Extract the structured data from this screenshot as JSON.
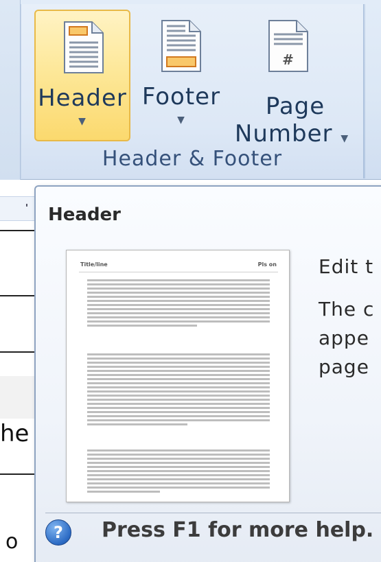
{
  "ribbon": {
    "buttons": {
      "header": {
        "label": "Header",
        "icon": "header-doc-icon"
      },
      "footer": {
        "label": "Footer",
        "icon": "footer-doc-icon"
      },
      "page_number": {
        "label_line1": "Page",
        "label_line2": "Number",
        "icon": "page-number-doc-icon",
        "glyph": "#"
      }
    },
    "dropdown_arrow": "▼",
    "group_label": "Header & Footer",
    "accent": "#fbd96e"
  },
  "document": {
    "fragment_1": "he",
    "fragment_2": "o"
  },
  "tooltip": {
    "title": "Header",
    "thumbnail": {
      "header_left": "Title/line",
      "header_right": "Pls on"
    },
    "description_1": "Edit t",
    "description_2_line1": "The c",
    "description_2_line2": "appe",
    "description_2_line3": "page",
    "help_icon": "?",
    "help_text": "Press F1 for more help."
  }
}
